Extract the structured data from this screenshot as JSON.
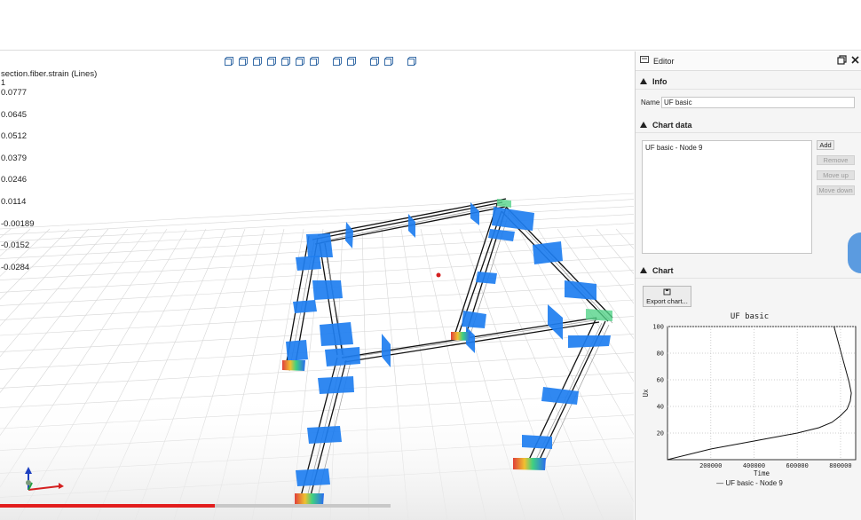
{
  "toolbar": {
    "icons": [
      "view-iso-icon",
      "view-front-icon",
      "view-back-icon",
      "view-left-icon",
      "view-right-icon",
      "view-top-icon",
      "view-bottom-icon",
      "perspective-icon",
      "parallel-icon",
      "fit-all-icon",
      "zoom-icon",
      "grid-icon"
    ]
  },
  "legend": {
    "title": "section.fiber.strain (Lines)",
    "subtitle": "1",
    "ticks": [
      "0.0777",
      "0.0645",
      "0.0512",
      "0.0379",
      "0.0246",
      "0.0114",
      "-0.00189",
      "-0.0152",
      "-0.0284"
    ]
  },
  "playback": {
    "progress": 0.55
  },
  "editor": {
    "title": "Editor",
    "sections": {
      "info": "Info",
      "chart_data": "Chart data",
      "chart": "Chart"
    },
    "name_label": "Name",
    "name_value": "UF basic",
    "series_items": [
      "UF basic - Node 9"
    ],
    "buttons": {
      "add": "Add",
      "remove": "Remove",
      "move_up": "Move up",
      "move_down": "Move down"
    },
    "export_label": "Export chart..."
  },
  "colors": {
    "accent": "#5b9be0",
    "progress": "#e21d1d",
    "panel": "#1e7ef0"
  },
  "chart_data": {
    "type": "line",
    "title": "UF basic",
    "xlabel": "Time",
    "ylabel": "Ux",
    "xticks": [
      "200000",
      "400000",
      "600000",
      "800000"
    ],
    "yticks": [
      "20",
      "40",
      "60",
      "80",
      "100"
    ],
    "xlim": [
      0,
      870000
    ],
    "ylim": [
      0,
      100
    ],
    "series": [
      {
        "name": "UF basic - Node 9",
        "x": [
          0,
          100000,
          200000,
          300000,
          400000,
          500000,
          600000,
          700000,
          760000,
          800000,
          830000,
          845000,
          850000,
          840000,
          820000,
          795000,
          770000
        ],
        "y": [
          0,
          4,
          8,
          11,
          14,
          17,
          20,
          24,
          28,
          33,
          38,
          44,
          50,
          58,
          70,
          85,
          100
        ]
      }
    ]
  }
}
